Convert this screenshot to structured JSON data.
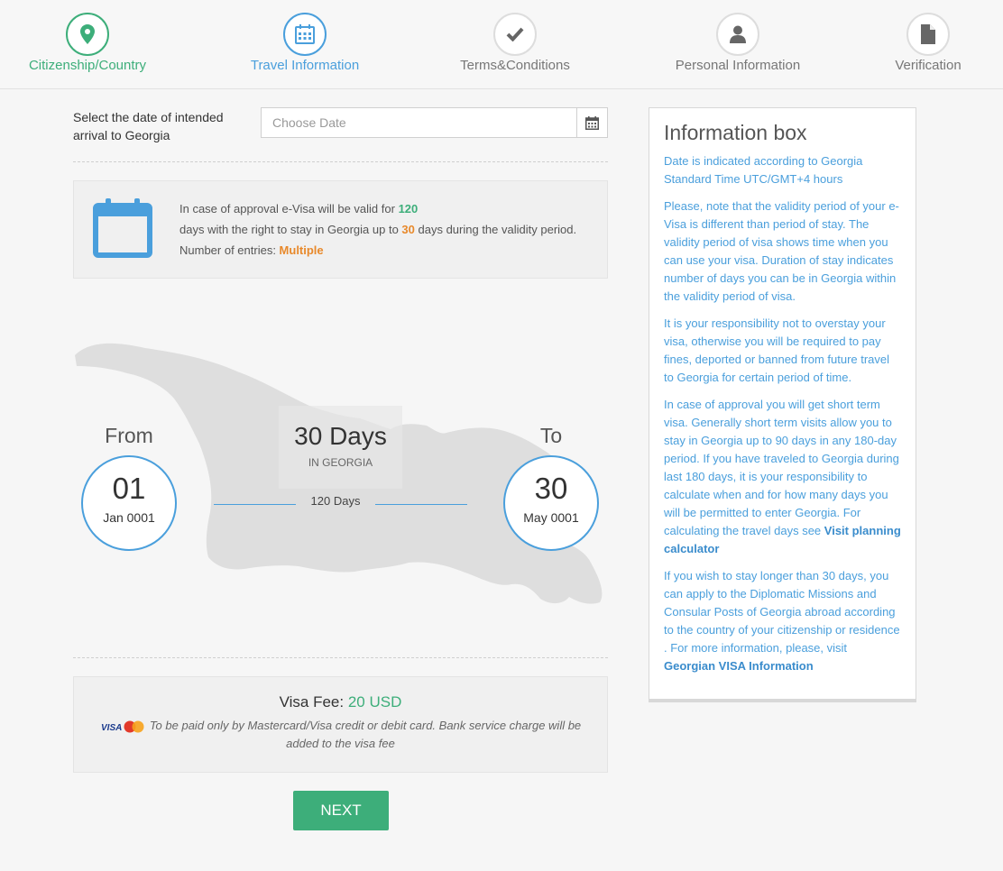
{
  "stepper": {
    "steps": [
      {
        "label": "Citizenship/Country",
        "icon": "map-pin-icon",
        "state": "done"
      },
      {
        "label": "Travel Information",
        "icon": "calendar-icon",
        "state": "active"
      },
      {
        "label": "Terms&Conditions",
        "icon": "checkmark-icon",
        "state": "pending"
      },
      {
        "label": "Personal Information",
        "icon": "person-icon",
        "state": "pending"
      },
      {
        "label": "Verification",
        "icon": "document-icon",
        "state": "pending"
      }
    ]
  },
  "date_select": {
    "label": "Select the date of intended arrival to Georgia",
    "placeholder": "Choose Date",
    "button_icon": "calendar-icon"
  },
  "validity": {
    "line1_prefix": "In case of approval e-Visa will be valid for ",
    "valid_days": "120",
    "line2_prefix": "days with the right to stay in Georgia up to ",
    "stay_days": "30",
    "line2_suffix": " days during the validity period.",
    "entries_prefix": "Number of entries: ",
    "entries_value": "Multiple"
  },
  "stay_map": {
    "from_label": "From",
    "from_day": "01",
    "from_month": "Jan 0001",
    "to_label": "To",
    "to_day": "30",
    "to_month": "May 0001",
    "days_title": "30 Days",
    "days_sub": "IN GEORGIA",
    "span_label": "120 Days"
  },
  "fee": {
    "label": "Visa Fee: ",
    "amount": "20 USD",
    "note": "To be paid only by Mastercard/Visa credit or debit card. Bank service charge will be added to the visa fee",
    "card_visa": "VISA",
    "card_mc": "MasterCard"
  },
  "next_label": "NEXT",
  "info_box": {
    "title": "Information box",
    "p1": "Date is indicated according to Georgia Standard Time UTC/GMT+4 hours",
    "p2": "Please, note that the validity period of your e-Visa is different than period of stay. The validity period of visa shows time when you can use your visa. Duration of stay indicates number of days you can be in Georgia within the validity period of visa.",
    "p3": "It is your responsibility not to overstay your visa, otherwise you will be required to pay fines, deported or banned from future travel to Georgia for certain period of time.",
    "p4_text": "In case of approval you will get short term visa. Generally short term visits allow you to stay in Georgia up to 90 days in any 180-day period. If you have traveled to Georgia during last 180 days, it is your responsibility to calculate when and for how many days you will be permitted to enter Georgia. For calculating the travel days see ",
    "p4_link": "Visit planning calculator",
    "p5_text": "If you wish to stay longer than 30 days, you can apply to the Diplomatic Missions and Consular Posts of Georgia abroad according to the country of your citizenship or residence . For more information, please, visit ",
    "p5_link": "Georgian VISA Information"
  },
  "colors": {
    "green": "#3dae7a",
    "blue": "#4a9fdc",
    "orange": "#e8892b"
  }
}
